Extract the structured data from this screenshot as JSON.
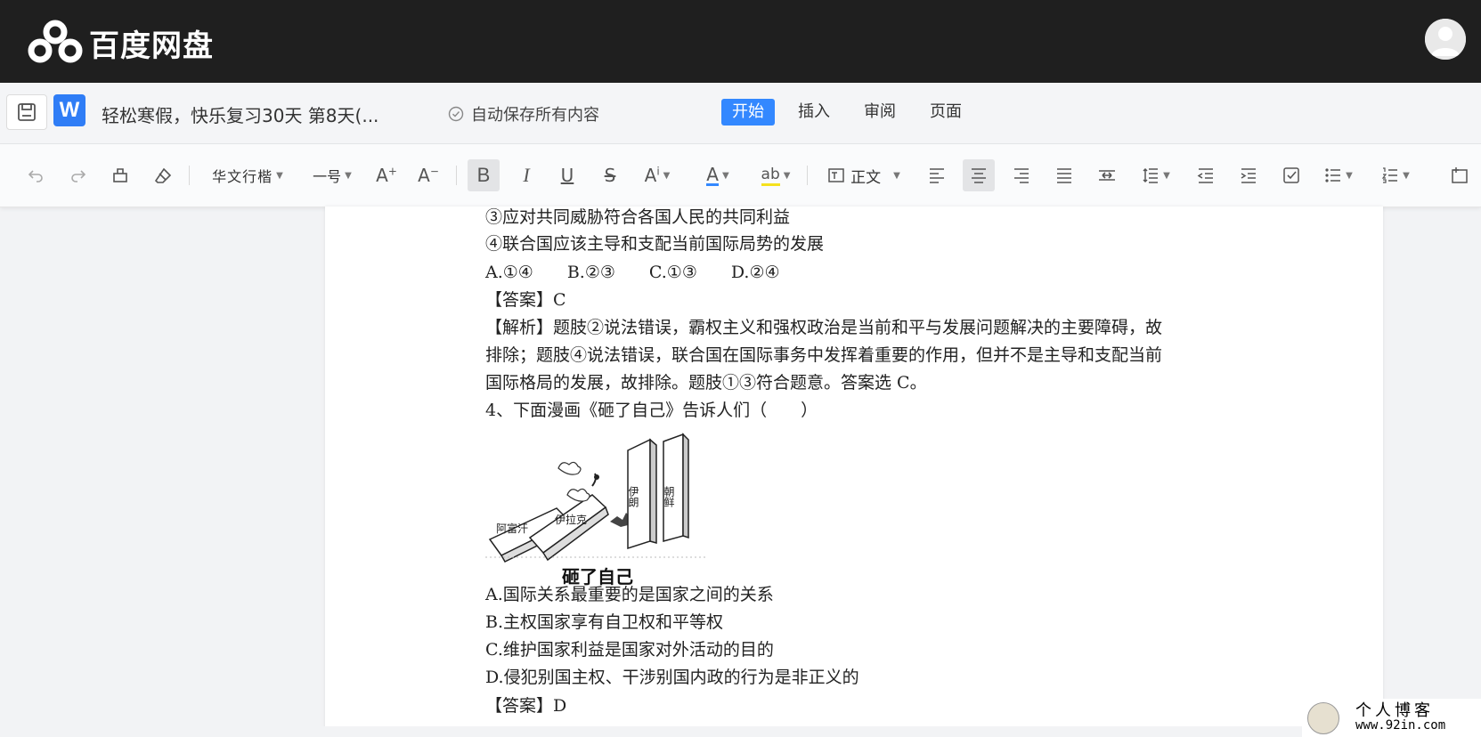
{
  "brand": {
    "name": "百度网盘"
  },
  "docbar": {
    "title": "轻松寒假，快乐复习30天 第8天(...",
    "autosave": "自动保存所有内容",
    "tabs": [
      {
        "label": "开始",
        "active": true
      },
      {
        "label": "插入",
        "active": false
      },
      {
        "label": "审阅",
        "active": false
      },
      {
        "label": "页面",
        "active": false
      }
    ]
  },
  "toolbar": {
    "font_name": "华文行楷",
    "font_size": "一号",
    "style": "正文"
  },
  "document": {
    "lines": [
      "③应对共同威胁符合各国人民的共同利益",
      "④联合国应该主导和支配当前国际局势的发展",
      "A.①④　　B.②③　　C.①③　　D.②④",
      "【答案】C",
      "【解析】题肢②说法错误，霸权主义和强权政治是当前和平与发展问题解决的主要障碍，故",
      "排除；题肢④说法错误，联合国在国际事务中发挥着重要的作用，但并不是主导和支配当前",
      "国际格局的发展，故排除。题肢①③符合题意。答案选 C。",
      "4、下面漫画《砸了自己》告诉人们（　　）"
    ],
    "cartoon": {
      "caption": "砸了自己",
      "labels": [
        "阿富汗",
        "伊拉克",
        "伊朗",
        "朝鲜"
      ]
    },
    "options": [
      "A.国际关系最重要的是国家之间的关系",
      "B.主权国家享有自卫权和平等权",
      "C.维护国家利益是国家对外活动的目的",
      "D.侵犯别国主权、干涉别国内政的行为是非正义的",
      "【答案】D"
    ]
  },
  "watermark": {
    "title": "个人博客",
    "url": "www.92in.com"
  },
  "colors": {
    "accent": "#3388ff",
    "brandbar": "#1f1f1f",
    "word": "#2f7df6"
  }
}
